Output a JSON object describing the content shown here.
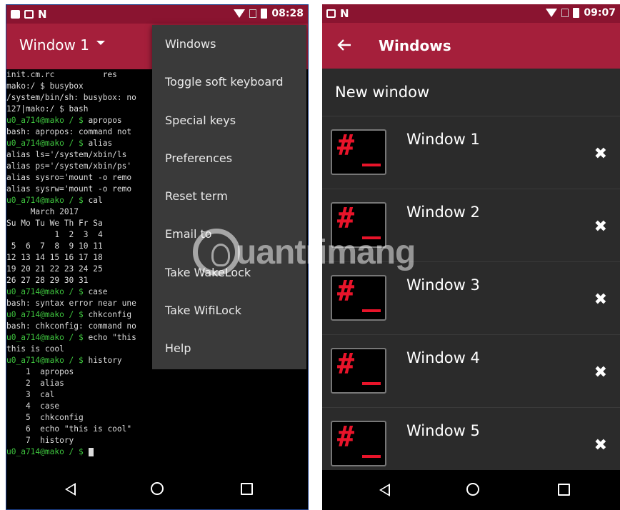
{
  "left": {
    "status": {
      "time": "08:28"
    },
    "appbar": {
      "title": "Window 1"
    },
    "terminal": [
      [
        {
          "t": "init.cm.rc          res",
          "c": "w"
        }
      ],
      [
        {
          "t": "mako:/ $ busybox",
          "c": "w"
        }
      ],
      [
        {
          "t": "/system/bin/sh: busybox: no",
          "c": "w"
        }
      ],
      [
        {
          "t": "127|mako:/ $ bash",
          "c": "w"
        }
      ],
      [
        {
          "t": "u0_a714@mako / $",
          "c": "g"
        },
        {
          "t": " apropos",
          "c": "w"
        }
      ],
      [
        {
          "t": "bash: apropos: command not",
          "c": "w"
        }
      ],
      [
        {
          "t": "u0_a714@mako / $",
          "c": "g"
        },
        {
          "t": " alias",
          "c": "w"
        }
      ],
      [
        {
          "t": "alias ls='/system/xbin/ls",
          "c": "w"
        }
      ],
      [
        {
          "t": "alias ps='/system/xbin/ps'",
          "c": "w"
        }
      ],
      [
        {
          "t": "alias sysro='mount -o remo",
          "c": "w"
        }
      ],
      [
        {
          "t": "alias sysrw='mount -o remo",
          "c": "w"
        }
      ],
      [
        {
          "t": "u0_a714@mako / $",
          "c": "g"
        },
        {
          "t": " cal",
          "c": "w"
        }
      ],
      [
        {
          "t": "     March 2017",
          "c": "w"
        }
      ],
      [
        {
          "t": "Su Mo Tu We Th Fr Sa",
          "c": "w"
        }
      ],
      [
        {
          "t": "          1  2  3  4",
          "c": "w"
        }
      ],
      [
        {
          "t": " 5  6  7  8  9 10 11",
          "c": "w"
        }
      ],
      [
        {
          "t": "12 13 14 15 16 17 18",
          "c": "w"
        }
      ],
      [
        {
          "t": "19 20 21 22 23 24 25",
          "c": "w"
        }
      ],
      [
        {
          "t": "26 27 28 29 30 31",
          "c": "w"
        }
      ],
      [
        {
          "t": "",
          "c": "w"
        }
      ],
      [
        {
          "t": "u0_a714@mako / $",
          "c": "g"
        },
        {
          "t": " case",
          "c": "w"
        }
      ],
      [
        {
          "t": "bash: syntax error near une",
          "c": "w"
        }
      ],
      [
        {
          "t": "u0_a714@mako / $",
          "c": "g"
        },
        {
          "t": " chkconfig",
          "c": "w"
        }
      ],
      [
        {
          "t": "bash: chkconfig: command no",
          "c": "w"
        }
      ],
      [
        {
          "t": "u0_a714@mako / $",
          "c": "g"
        },
        {
          "t": " echo \"this",
          "c": "w"
        }
      ],
      [
        {
          "t": "this is cool",
          "c": "w"
        }
      ],
      [
        {
          "t": "u0_a714@mako / $",
          "c": "g"
        },
        {
          "t": " history",
          "c": "w"
        }
      ],
      [
        {
          "t": "    1  apropos",
          "c": "w"
        }
      ],
      [
        {
          "t": "    2  alias",
          "c": "w"
        }
      ],
      [
        {
          "t": "    3  cal",
          "c": "w"
        }
      ],
      [
        {
          "t": "    4  case",
          "c": "w"
        }
      ],
      [
        {
          "t": "    5  chkconfig",
          "c": "w"
        }
      ],
      [
        {
          "t": "    6  echo \"this is cool\"",
          "c": "w"
        }
      ],
      [
        {
          "t": "    7  history",
          "c": "w"
        }
      ],
      [
        {
          "t": "u0_a714@mako / $",
          "c": "g"
        },
        {
          "t": " ",
          "c": "w"
        }
      ]
    ],
    "menu": [
      "Windows",
      "Toggle soft keyboard",
      "Special keys",
      "Preferences",
      "Reset term",
      "Email to",
      "Take WakeLock",
      "Take WifiLock",
      "Help"
    ]
  },
  "right": {
    "status": {
      "time": "09:07"
    },
    "appbar": {
      "title": "Windows"
    },
    "new_window_label": "New window",
    "windows": [
      {
        "name": "Window 1",
        "close_glyph": "✖"
      },
      {
        "name": "Window 2",
        "close_glyph": "✖"
      },
      {
        "name": "Window 3",
        "close_glyph": "✖"
      },
      {
        "name": "Window 4",
        "close_glyph": "✖"
      },
      {
        "name": "Window 5",
        "close_glyph": "✖"
      }
    ],
    "thumb_glyph": "#"
  },
  "watermark": {
    "text": "uantrimang"
  },
  "colors": {
    "accent": "#a51f3b",
    "status_bar": "#8a1430",
    "prompt_green": "#3ec43e",
    "hash_red": "#e8142a"
  }
}
